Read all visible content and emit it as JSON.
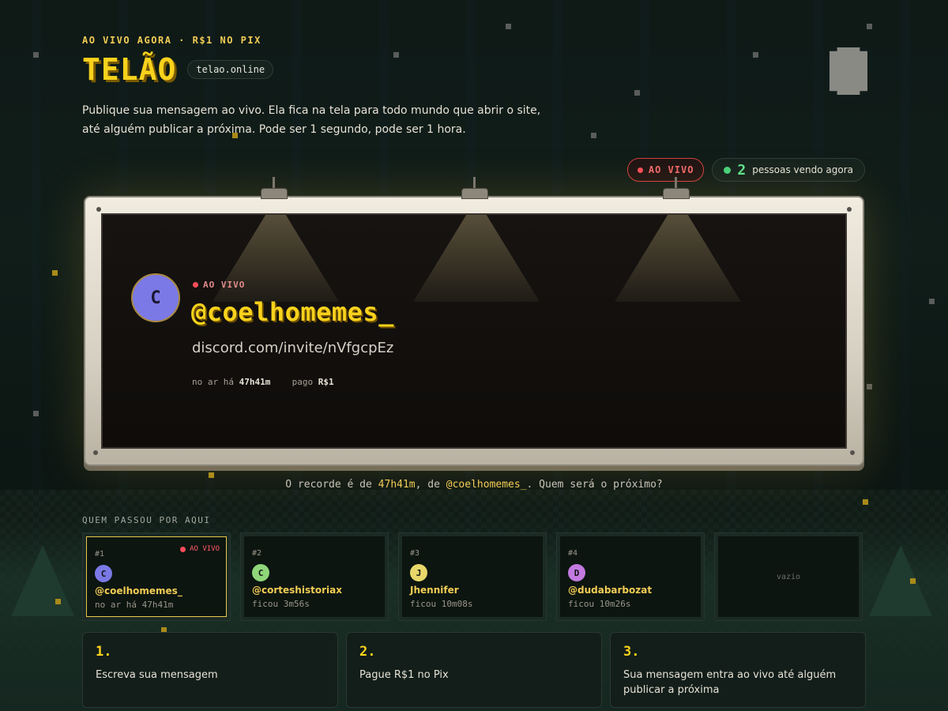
{
  "header": {
    "eyebrow": "AO VIVO AGORA · R$1 NO PIX",
    "brand": "TELÃO",
    "domain": "telao.online",
    "lead": "Publique sua mensagem ao vivo. Ela fica na tela para todo mundo que abrir o site, até alguém publicar a próxima. Pode ser 1 segundo, pode ser 1 hora."
  },
  "status": {
    "live_label": "AO VIVO",
    "viewers_count": "2",
    "viewers_label": "pessoas vendo agora"
  },
  "board": {
    "avatar_letter": "C",
    "live_label": "AO VIVO",
    "handle": "@coelhomemes_",
    "link": "discord.com/invite/nVfgcpEz",
    "meta_air_label": "no ar há",
    "meta_air_value": "47h41m",
    "meta_paid_label": "pago",
    "meta_paid_value": "R$1"
  },
  "record": {
    "prefix": "O recorde é de ",
    "time": "47h41m",
    "middle": ", de ",
    "user": "@coelhomemes_",
    "suffix": ". Quem será o próximo?"
  },
  "history": {
    "label": "QUEM PASSOU POR AQUI",
    "slots": [
      {
        "rank": "#1",
        "live": "AO VIVO",
        "letter": "C",
        "name": "@coelhomemes_",
        "stat": "no ar há 47h41m",
        "color": "#7b79e6"
      },
      {
        "rank": "#2",
        "letter": "C",
        "name": "@corteshistoriax",
        "stat": "ficou 3m56s",
        "color": "#8fd67a"
      },
      {
        "rank": "#3",
        "letter": "J",
        "name": "Jhennifer",
        "stat": "ficou 10m08s",
        "color": "#e8d86a"
      },
      {
        "rank": "#4",
        "letter": "D",
        "name": "@dudabarbozat",
        "stat": "ficou 10m26s",
        "color": "#c37ae0"
      }
    ],
    "empty_label": "vazio"
  },
  "steps": [
    {
      "num": "1.",
      "text": "Escreva sua mensagem"
    },
    {
      "num": "2.",
      "text": "Pague R$1 no Pix"
    },
    {
      "num": "3.",
      "text": "Sua mensagem entra ao vivo até alguém publicar a próxima"
    }
  ]
}
